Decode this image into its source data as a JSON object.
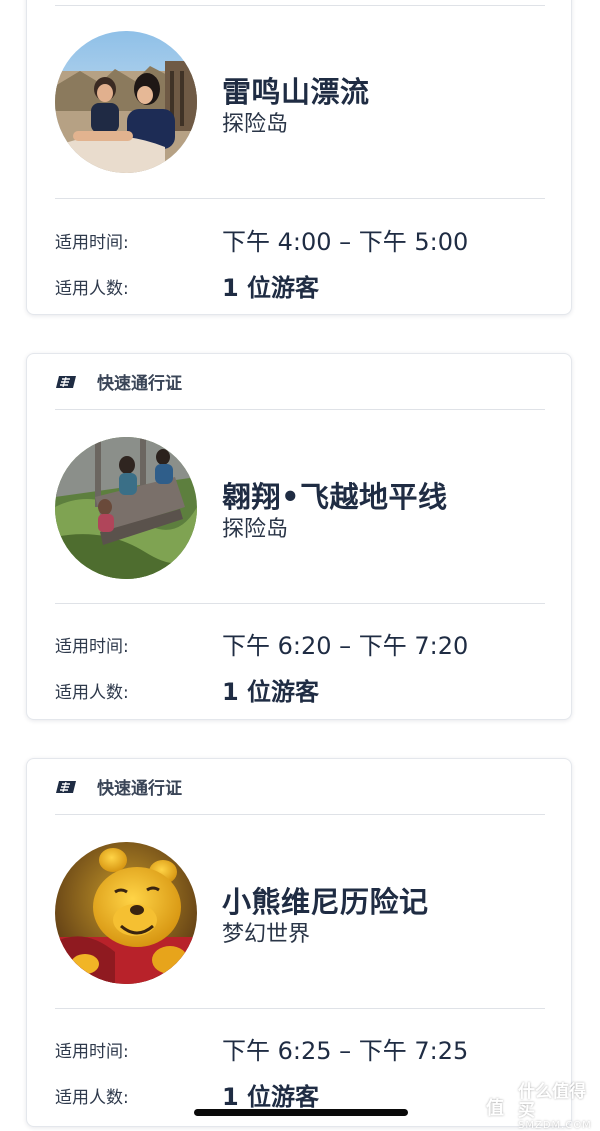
{
  "cards": [
    {
      "tag_label": "",
      "attraction": "雷鸣山漂流",
      "land": "探险岛",
      "time_label": "适用时间:",
      "time_value": "下午 4:00 – 下午 5:00",
      "guests_label": "适用人数:",
      "guests_value": "1 位游客",
      "image_icon": "attraction-photo-raft-riders"
    },
    {
      "tag_label": "快速通行证",
      "attraction": "翱翔•飞越地平线",
      "land": "探险岛",
      "time_label": "适用时间:",
      "time_value": "下午 6:20 – 下午 7:20",
      "guests_label": "适用人数:",
      "guests_value": "1 位游客",
      "image_icon": "attraction-photo-soaring-riders"
    },
    {
      "tag_label": "快速通行证",
      "attraction": "小熊维尼历险记",
      "land": "梦幻世界",
      "time_label": "适用时间:",
      "time_value": "下午 6:25 – 下午 7:25",
      "guests_label": "适用人数:",
      "guests_value": "1 位游客",
      "image_icon": "attraction-photo-winnie-the-pooh"
    }
  ],
  "watermark": {
    "cn": "什么值得买",
    "en": "SMZDM.COM",
    "icon": "smzdm-logo-icon"
  },
  "colors": {
    "text_dark": "#1f2c43",
    "divider": "#dfe2e7",
    "card_border": "#e4e7ec"
  }
}
